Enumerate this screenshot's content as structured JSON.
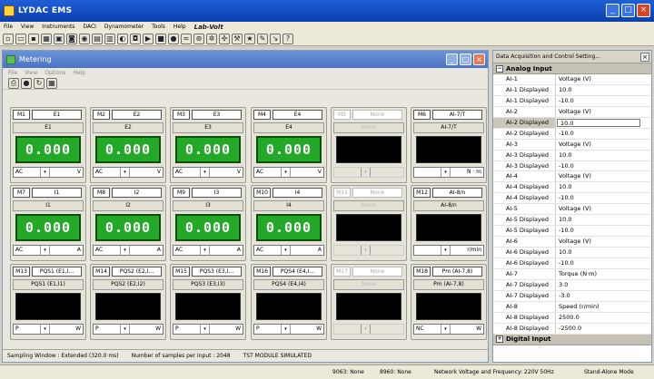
{
  "app": {
    "title": "LYDAC EMS"
  },
  "menu": {
    "items": [
      "File",
      "View",
      "Instruments",
      "DACI",
      "Dynamometer",
      "Tools",
      "Help"
    ],
    "logo": "Lab-Volt"
  },
  "toolbar": {
    "icons": [
      "new-icon",
      "open-icon",
      "save-icon",
      "grid-icon",
      "meter-icon",
      "scope-icon",
      "phasor-icon",
      "harmonic-icon",
      "table-icon",
      "graph-icon",
      "camera-icon",
      "play-icon",
      "stop-icon",
      "record-icon",
      "wire-icon",
      "motor-icon",
      "gear-icon",
      "fan-icon",
      "tool-icon",
      "star-icon",
      "wrench-icon",
      "probe-icon",
      "help-icon"
    ]
  },
  "metering": {
    "title": "Metering",
    "menu": [
      "File",
      "View",
      "Options",
      "Help"
    ],
    "cards": [
      {
        "id": "M1",
        "channel": "E1",
        "name": "E1",
        "value": "0.000",
        "mode": "AC",
        "unit": "V",
        "active": true
      },
      {
        "id": "M2",
        "channel": "E2",
        "name": "E2",
        "value": "0.000",
        "mode": "AC",
        "unit": "V",
        "active": true
      },
      {
        "id": "M3",
        "channel": "E3",
        "name": "E3",
        "value": "0.000",
        "mode": "AC",
        "unit": "V",
        "active": true
      },
      {
        "id": "M4",
        "channel": "E4",
        "name": "E4",
        "value": "0.000",
        "mode": "AC",
        "unit": "V",
        "active": true
      },
      {
        "id": "M5",
        "channel": "None",
        "name": "None",
        "value": "",
        "mode": "",
        "unit": "",
        "active": false
      },
      {
        "id": "M6",
        "channel": "AI-7/T",
        "name": "AI-7/T",
        "value": "",
        "mode": "",
        "unit": "N · m",
        "active": false
      },
      {
        "id": "M7",
        "channel": "I1",
        "name": "I1",
        "value": "0.000",
        "mode": "AC",
        "unit": "A",
        "active": true
      },
      {
        "id": "M8",
        "channel": "I2",
        "name": "I2",
        "value": "0.000",
        "mode": "AC",
        "unit": "A",
        "active": true
      },
      {
        "id": "M9",
        "channel": "I3",
        "name": "I3",
        "value": "0.000",
        "mode": "AC",
        "unit": "A",
        "active": true
      },
      {
        "id": "M10",
        "channel": "I4",
        "name": "I4",
        "value": "0.000",
        "mode": "AC",
        "unit": "A",
        "active": true
      },
      {
        "id": "M11",
        "channel": "None",
        "name": "None",
        "value": "",
        "mode": "",
        "unit": "",
        "active": false
      },
      {
        "id": "M12",
        "channel": "AI-8/n",
        "name": "AI-8/n",
        "value": "",
        "mode": "",
        "unit": "r/min",
        "active": false
      },
      {
        "id": "M13",
        "channel": "PQS1 (E1,I...",
        "name": "PQS1 (E1,I1)",
        "value": "",
        "mode": "P",
        "unit": "W",
        "active": false
      },
      {
        "id": "M14",
        "channel": "PQS2 (E2,I...",
        "name": "PQS2 (E2,I2)",
        "value": "",
        "mode": "P",
        "unit": "W",
        "active": false
      },
      {
        "id": "M15",
        "channel": "PQS3 (E3,I...",
        "name": "PQS3 (E3,I3)",
        "value": "",
        "mode": "P",
        "unit": "W",
        "active": false
      },
      {
        "id": "M16",
        "channel": "PQS4 (E4,I...",
        "name": "PQS4 (E4,I4)",
        "value": "",
        "mode": "P",
        "unit": "W",
        "active": false
      },
      {
        "id": "M17",
        "channel": "None",
        "name": "None",
        "value": "",
        "mode": "",
        "unit": "",
        "active": false
      },
      {
        "id": "M18",
        "channel": "Pm (AI-7,8)",
        "name": "Pm (AI-7,8)",
        "value": "",
        "mode": "NC",
        "unit": "W",
        "active": false
      }
    ],
    "status": {
      "sampling": "Sampling Window : Extended (320.0 ms)",
      "samples": "Number of samples per input : 2048",
      "module": "TST MODULE SIMULATED"
    }
  },
  "panel": {
    "title": "Data Acquisition and Control Setting...",
    "section_analog": "Analog Input",
    "section_digital": "Digital Input",
    "props": [
      {
        "k": "AI-1",
        "v": "Voltage (V)"
      },
      {
        "k": "AI-1 Displayed",
        "v": "10.0"
      },
      {
        "k": "AI-1 Displayed",
        "v": "-10.0"
      },
      {
        "k": "AI-2",
        "v": "Voltage (V)"
      },
      {
        "k": "AI-2 Displayed",
        "v": "10.0"
      },
      {
        "k": "AI-2 Displayed",
        "v": "-10.0"
      },
      {
        "k": "AI-3",
        "v": "Voltage (V)"
      },
      {
        "k": "AI-3 Displayed",
        "v": "10.0"
      },
      {
        "k": "AI-3 Displayed",
        "v": "-10.0"
      },
      {
        "k": "AI-4",
        "v": "Voltage (V)"
      },
      {
        "k": "AI-4 Displayed",
        "v": "10.0"
      },
      {
        "k": "AI-4 Displayed",
        "v": "-10.0"
      },
      {
        "k": "AI-5",
        "v": "Voltage (V)"
      },
      {
        "k": "AI-5 Displayed",
        "v": "10.0"
      },
      {
        "k": "AI-5 Displayed",
        "v": "-10.0"
      },
      {
        "k": "AI-6",
        "v": "Voltage (V)"
      },
      {
        "k": "AI-6 Displayed",
        "v": "10.0"
      },
      {
        "k": "AI-6 Displayed",
        "v": "-10.0"
      },
      {
        "k": "AI-7",
        "v": "Torque (N·m)"
      },
      {
        "k": "AI-7 Displayed",
        "v": "3.0"
      },
      {
        "k": "AI-7 Displayed",
        "v": "-3.0"
      },
      {
        "k": "AI-8",
        "v": "Speed (r/min)"
      },
      {
        "k": "AI-8 Displayed",
        "v": "2500.0"
      },
      {
        "k": "AI-8 Displayed",
        "v": "-2500.0"
      }
    ]
  },
  "statusbar": {
    "s9063": "9063: None",
    "s8960": "8960: None",
    "network": "Network Voltage and Frequency: 220V 50Hz",
    "mode": "Stand-Alone Mode"
  }
}
